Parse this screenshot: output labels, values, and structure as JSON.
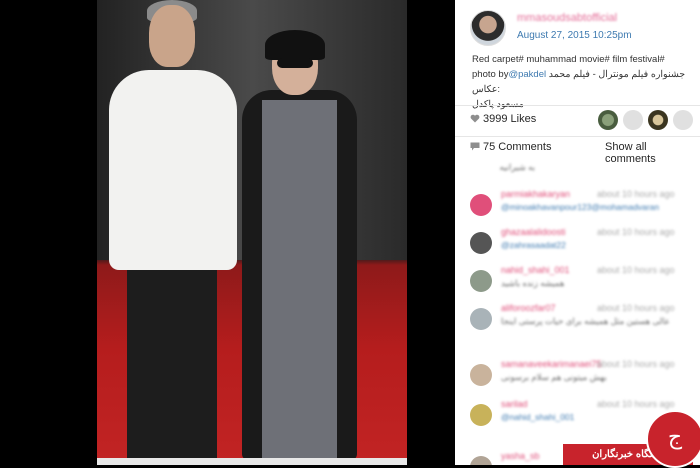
{
  "post": {
    "username": "mmasoudsabtofficial",
    "date": "August 27, 2015 10:25pm",
    "caption_en": "Red carpet# muhammad movie# film festival#",
    "caption_fa": "جشنواره فیلم مونترال - فیلم محمد عکاس:",
    "caption_prefix": "photo by",
    "caption_mention": "@pakdel",
    "caption_fa2": "مسعود پاکدل",
    "likes_label": "3999 Likes",
    "comments_label": "75 Comments",
    "show_all_label": "Show all comments"
  },
  "comments": [
    {
      "user": "",
      "time": "",
      "text": "به شیرانیه"
    },
    {
      "user": "parmiakhakaryan",
      "time": "about 10 hours ago",
      "text": "@minoakhavanpour123@mohamadvaran"
    },
    {
      "user": "ghazaalalidoosti",
      "time": "about 10 hours ago",
      "text": "@zahrasaadat22"
    },
    {
      "user": "nahid_shahi_001",
      "time": "about 10 hours ago",
      "text": "همیشه زنده باشید"
    },
    {
      "user": "aliforoozfar07",
      "time": "about 10 hours ago",
      "text": "عالی هستین مثل همیشه برای حیات پرستی اینجا"
    },
    {
      "user": "samanaveekarimanaei75",
      "time": "about 10 hours ago",
      "text": "بهش میتونی هم سلام برسونی"
    },
    {
      "user": "sarilad",
      "time": "about 10 hours ago",
      "text": "@nahid_shahi_001"
    },
    {
      "user": "yasha_sb",
      "time": "",
      "text": ""
    }
  ],
  "watermark": {
    "label": "باشگاه خبرنگاران",
    "logo_text": "ج"
  },
  "colors": {
    "username": "#e46e98",
    "link": "#3e7ab0",
    "watermark": "#c8232c"
  },
  "icons": {
    "likes": "heart-icon",
    "comments": "speech-bubble-icon"
  }
}
